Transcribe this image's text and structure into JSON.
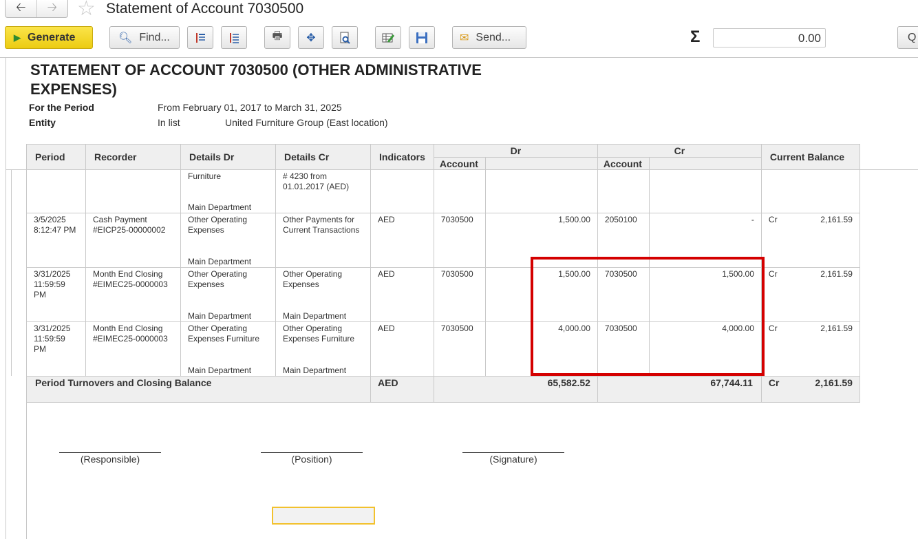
{
  "window": {
    "title": "Statement of Account 7030500"
  },
  "toolbar": {
    "generate_label": "Generate",
    "find_label": "Find...",
    "send_label": "Send...",
    "sum_value": "0.00",
    "more_label": "Q"
  },
  "report": {
    "title": "STATEMENT OF ACCOUNT 7030500 (OTHER ADMINISTRATIVE EXPENSES)",
    "period_label": "For the Period",
    "period_value": "From February 01, 2017 to March 31, 2025",
    "entity_label": "Entity",
    "entity_filter": "In list",
    "entity_value": "United Furniture Group (East location)",
    "columns": {
      "period": "Period",
      "recorder": "Recorder",
      "details_dr": "Details Dr",
      "details_cr": "Details Cr",
      "indicators": "Indicators",
      "dr": "Dr",
      "cr": "Cr",
      "account_dr": "Account",
      "account_cr": "Account",
      "current_balance": "Current Balance"
    },
    "rows": [
      {
        "period": "",
        "recorder": "",
        "details_dr": "Furniture",
        "details_dr_dept": "Main Department",
        "details_cr": "# 4230 from 01.01.2017 (AED)",
        "details_cr_dept": "",
        "indicator": "",
        "dr_account": "",
        "dr_amount": "",
        "cr_account": "",
        "cr_amount": "",
        "balance_type": "",
        "balance": ""
      },
      {
        "period": "3/5/2025 8:12:47 PM",
        "recorder": "Cash Payment #EICP25-00000002",
        "details_dr": "Other Operating Expenses",
        "details_dr_dept": "Main Department",
        "details_cr": "Other Payments for Current Transactions",
        "details_cr_dept": "",
        "indicator": "AED",
        "dr_account": "7030500",
        "dr_amount": "1,500.00",
        "cr_account": "2050100",
        "cr_amount": "-",
        "balance_type": "Cr",
        "balance": "2,161.59"
      },
      {
        "period": "3/31/2025 11:59:59 PM",
        "recorder": "Month End Closing #EIMEC25-0000003",
        "details_dr": "Other Operating Expenses",
        "details_dr_dept": "Main Department",
        "details_cr": "Other Operating Expenses",
        "details_cr_dept": "Main Department",
        "indicator": "AED",
        "dr_account": "7030500",
        "dr_amount": "1,500.00",
        "cr_account": "7030500",
        "cr_amount": "1,500.00",
        "balance_type": "Cr",
        "balance": "2,161.59"
      },
      {
        "period": "3/31/2025 11:59:59 PM",
        "recorder": "Month End Closing #EIMEC25-0000003",
        "details_dr": "Other Operating Expenses Furniture",
        "details_dr_dept": "Main Department",
        "details_cr": "Other Operating Expenses Furniture",
        "details_cr_dept": "Main Department",
        "indicator": "AED",
        "dr_account": "7030500",
        "dr_amount": "4,000.00",
        "cr_account": "7030500",
        "cr_amount": "4,000.00",
        "balance_type": "Cr",
        "balance": "2,161.59"
      }
    ],
    "totals": {
      "label": "Period Turnovers and Closing Balance",
      "indicator": "AED",
      "dr_total": "65,582.52",
      "cr_total": "67,744.11",
      "balance_type": "Cr",
      "balance": "2,161.59"
    },
    "signatures": {
      "responsible": "(Responsible)",
      "position": "(Position)",
      "signature": "(Signature)"
    }
  }
}
